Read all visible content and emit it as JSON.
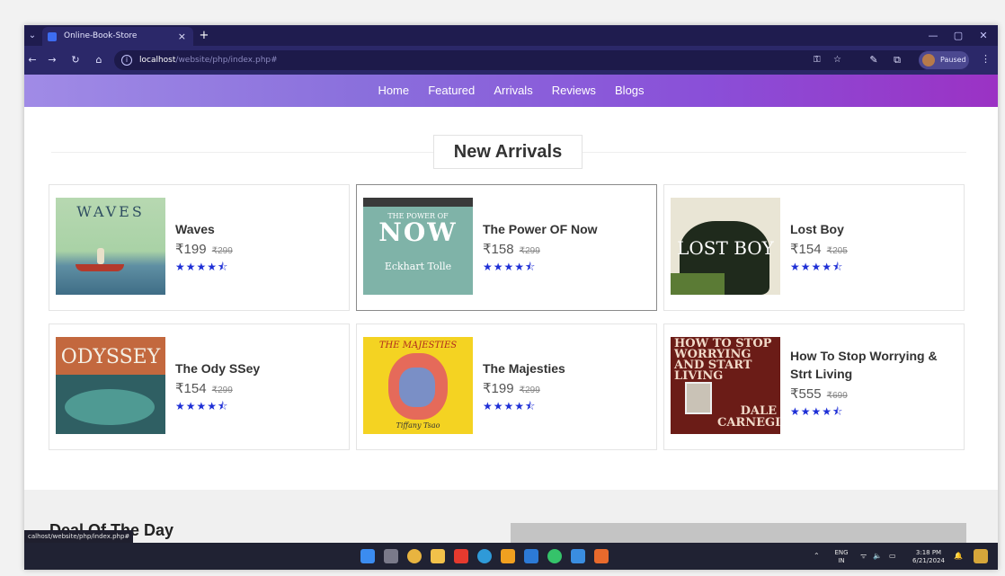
{
  "browser": {
    "tab_title": "Online-Book-Store",
    "tab_close": "×",
    "new_tab": "+",
    "url_host": "localhost",
    "url_path": "/website/php/index.php#",
    "profile_status": "Paused",
    "status_url": "calhost/website/php/index.php#"
  },
  "nav": {
    "items": [
      "Home",
      "Featured",
      "Arrivals",
      "Reviews",
      "Blogs"
    ]
  },
  "section": {
    "title": "New Arrivals"
  },
  "products": [
    {
      "title": "Waves",
      "price": "₹199",
      "old_price": "₹299",
      "rating": "★★★★⯪",
      "cover_text": "WAVES"
    },
    {
      "title": "The Power OF Now",
      "price": "₹158",
      "old_price": "₹299",
      "rating": "★★★★⯪",
      "cover_text_1": "THE POWER OF",
      "cover_text_2": "NOW",
      "cover_text_3": "Eckhart Tolle"
    },
    {
      "title": "Lost Boy",
      "price": "₹154",
      "old_price": "₹205",
      "rating": "★★★★⯪",
      "cover_text": "LOST BOY"
    },
    {
      "title": "The Ody SSey",
      "price": "₹154",
      "old_price": "₹299",
      "rating": "★★★★⯪",
      "cover_text": "ODYSSEY"
    },
    {
      "title": "The Majesties",
      "price": "₹199",
      "old_price": "₹299",
      "rating": "★★★★⯪",
      "cover_text": "THE MAJESTIES",
      "cover_author": "Tiffany Tsao"
    },
    {
      "title": "How To Stop Worrying & Strt Living",
      "price": "₹555",
      "old_price": "₹699",
      "rating": "★★★★⯪",
      "cover_text": "HOW TO STOP WORRYING AND START LIVING",
      "cover_author": "DALE CARNEGIE"
    }
  ],
  "deal": {
    "title": "Deal Of The Day"
  },
  "taskbar": {
    "lang_1": "ENG",
    "lang_2": "IN",
    "time": "3:18 PM",
    "date": "6/21/2024"
  },
  "colors": {
    "nav_gradient_start": "#a08be6",
    "nav_gradient_end": "#9b32c4",
    "star_color": "#1e2fd6",
    "browser_bar": "#2b2869"
  }
}
